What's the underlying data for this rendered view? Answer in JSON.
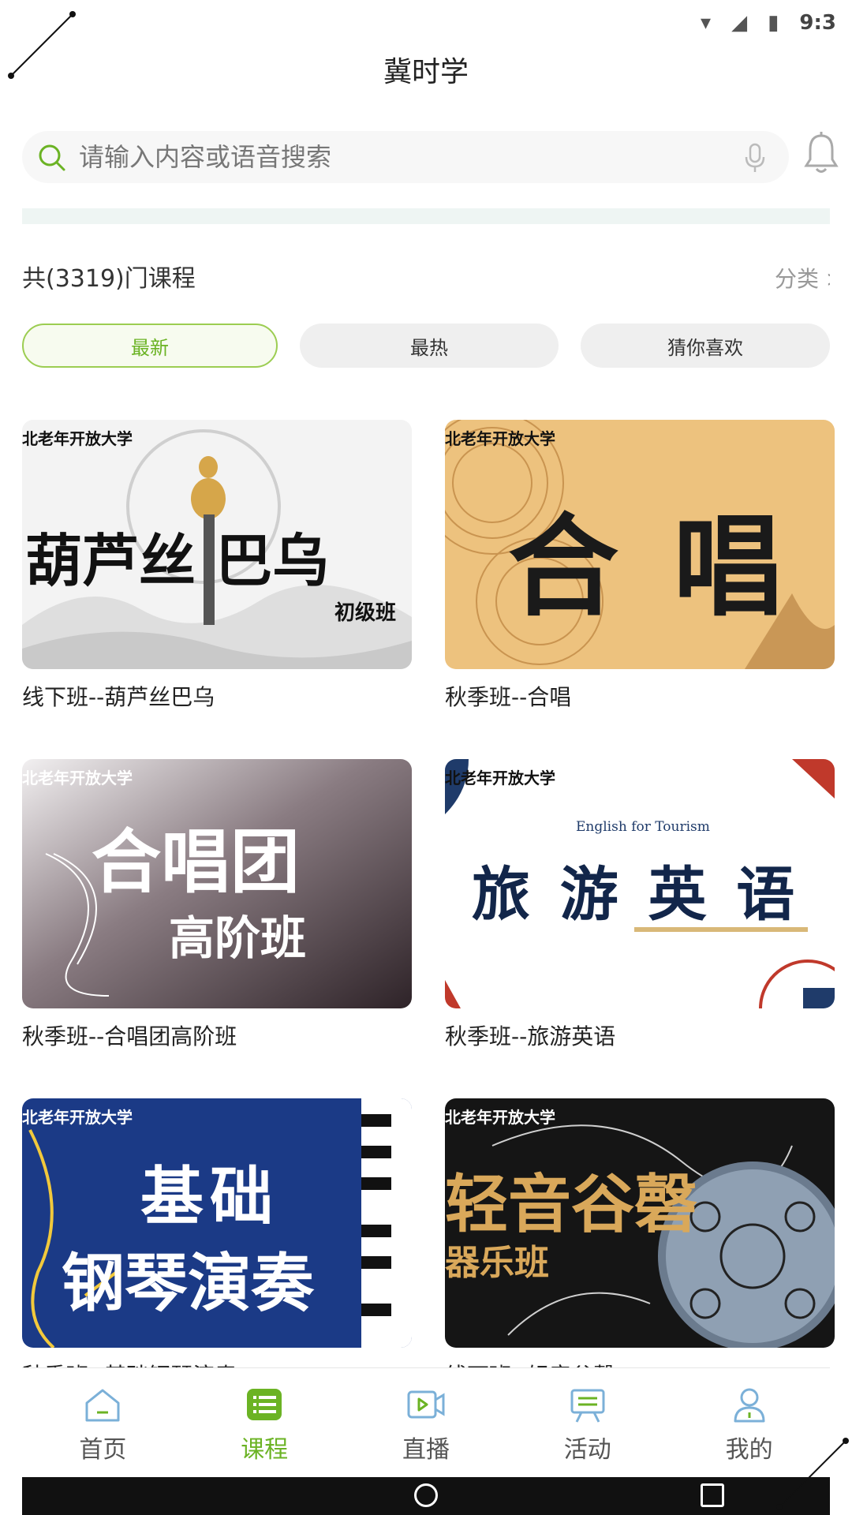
{
  "status_bar": {
    "time": "9:3"
  },
  "app": {
    "title": "冀时学"
  },
  "search": {
    "placeholder": "请输入内容或语音搜索"
  },
  "courses_header": {
    "count_text": "共(3319)门课程",
    "category_text": "分类 >"
  },
  "filters": [
    {
      "label": "最新",
      "active": true
    },
    {
      "label": "最热",
      "active": false
    },
    {
      "label": "猜你喜欢",
      "active": false
    }
  ],
  "courses": [
    {
      "title": "线下班--葫芦丝巴乌",
      "thumb_tag": "北老年开放大学",
      "thumb_text": "葫芦丝 巴乌",
      "thumb_sub": "初级班"
    },
    {
      "title": "秋季班--合唱",
      "thumb_tag": "北老年开放大学",
      "thumb_text": "合 唱"
    },
    {
      "title": "秋季班--合唱团高阶班",
      "thumb_tag": "北老年开放大学",
      "thumb_text": "合唱团",
      "thumb_sub": "高阶班"
    },
    {
      "title": "秋季班--旅游英语",
      "thumb_tag": "北老年开放大学",
      "thumb_text": "旅 游 英 语",
      "thumb_sub": "English for Tourism"
    },
    {
      "title": "秋季班--基础钢琴演奏",
      "thumb_tag": "北老年开放大学",
      "thumb_text": "基础",
      "thumb_sub": "钢琴演奏"
    },
    {
      "title": "线下班--轻音谷磬",
      "thumb_tag": "北老年开放大学",
      "thumb_text": "轻音谷磬",
      "thumb_sub": "器乐班"
    }
  ],
  "tabs": [
    {
      "label": "首页",
      "icon": "home-icon",
      "active": false
    },
    {
      "label": "课程",
      "icon": "course-list-icon",
      "active": true
    },
    {
      "label": "直播",
      "icon": "live-video-icon",
      "active": false
    },
    {
      "label": "活动",
      "icon": "activity-board-icon",
      "active": false
    },
    {
      "label": "我的",
      "icon": "profile-icon",
      "active": false
    }
  ],
  "colors": {
    "accent": "#6bb324",
    "chip_border": "#9ccd52"
  }
}
